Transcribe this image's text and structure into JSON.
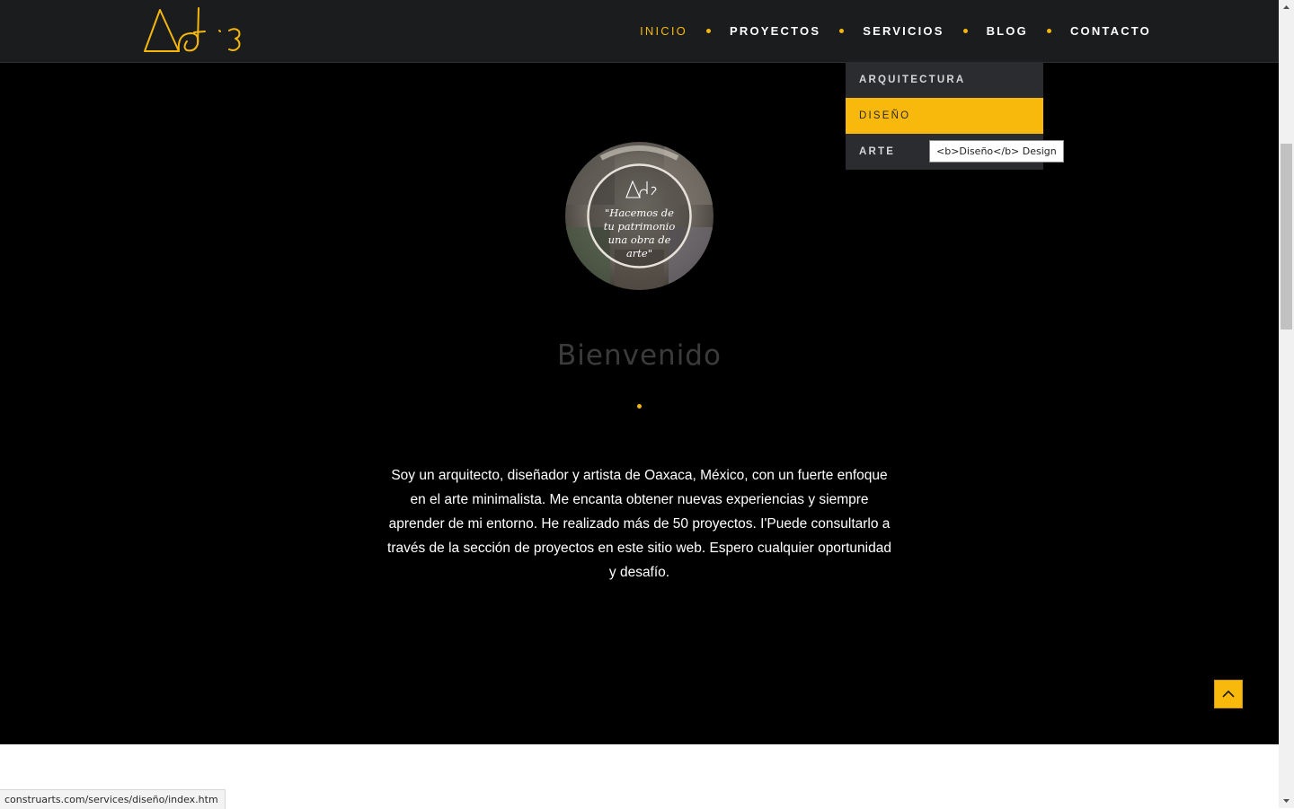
{
  "brand": {
    "logo_text": "Art·s",
    "accent_color": "#f5b70c"
  },
  "nav": {
    "items": [
      {
        "label": "INICIO",
        "active": true
      },
      {
        "label": "PROYECTOS",
        "active": false
      },
      {
        "label": "SERVICIOS",
        "active": false
      },
      {
        "label": "BLOG",
        "active": false
      },
      {
        "label": "CONTACTO",
        "active": false
      }
    ]
  },
  "dropdown": {
    "items": [
      {
        "label": "ARQUITECTURA"
      },
      {
        "label": "DISEÑO",
        "highlighted": true
      },
      {
        "label": "ARTE"
      }
    ]
  },
  "tooltip": {
    "text": "<b>Diseño</b> Design"
  },
  "hero": {
    "avatar_quote": "\"Hacemos de tu patrimonio una obra de arte\"",
    "welcome_title": "Bienvenido",
    "intro_text": "Soy un arquitecto, diseñador y artista de Oaxaca, México, con un fuerte enfoque en el arte minimalista. Me encanta obtener nuevas experiencias y siempre aprender de mi entorno. He realizado más de 50 proyectos. I'Puede consultarlo a través de la sección de proyectos en este sitio web. Espero cualquier oportunidad y desafío."
  },
  "status_bar": {
    "url": "construarts.com/services/diseño/index.htm"
  },
  "icons": {
    "scroll_top": "chevron-up-icon",
    "scroll_up": "triangle-up-icon",
    "scroll_down": "triangle-down-icon"
  }
}
